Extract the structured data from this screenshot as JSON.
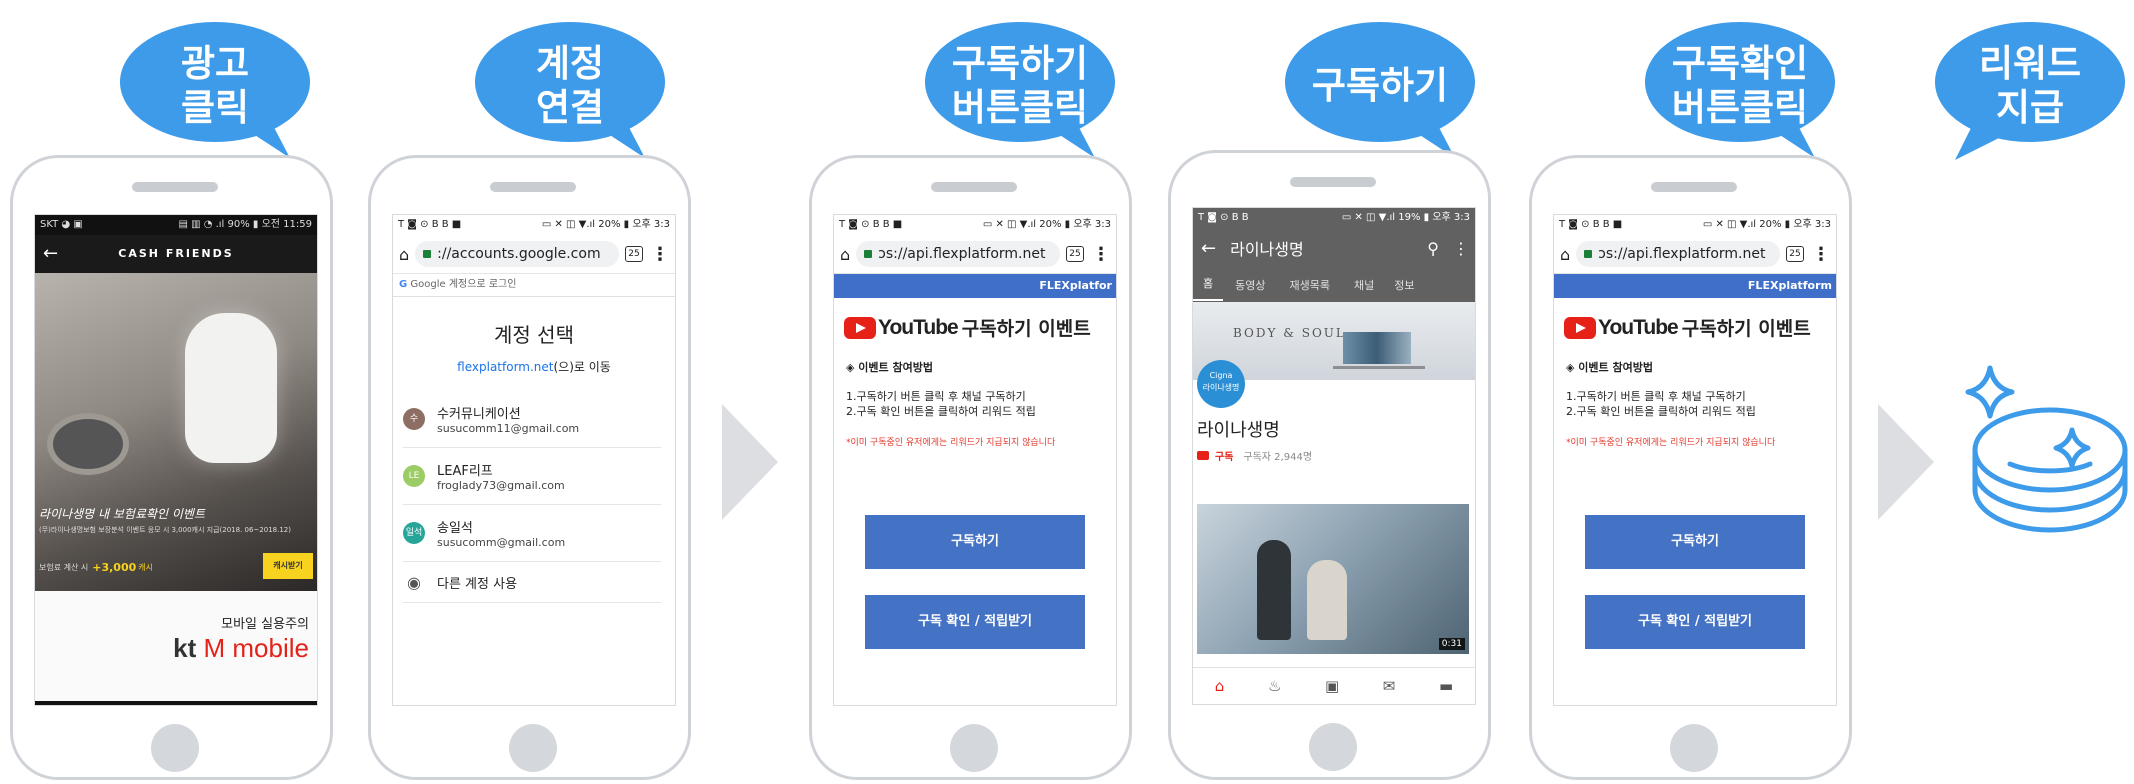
{
  "bubbles": [
    {
      "text": "광고\n클릭"
    },
    {
      "text": "계정\n연결"
    },
    {
      "text": "구독하기\n버튼클릭"
    },
    {
      "text": "구독하기"
    },
    {
      "text": "구독확인\n버튼클릭"
    },
    {
      "text": "리워드\n지급"
    }
  ],
  "colors": {
    "bubble": "#3d9be9",
    "button": "#4472c4",
    "flexbar": "#3f6fc8",
    "youtube_red": "#e62117",
    "warn": "#e23b2e",
    "chevron": "#dcdee2"
  },
  "phone1": {
    "status_left": "SKT ◕ ▣",
    "status_right": "▤ ▥ ◔ .ıl 90% ▮ 오전 11:59",
    "app_title": "CASH FRIENDS",
    "banner_text": "라이나생명 내 보험료확인 이벤트",
    "banner_sub": "(무)라이나생명보험 보장분석 이벤트 응모 시 3,000캐시 지급(2018. 06~2018.12)",
    "reward_label": "보험료 계산 시",
    "reward_value": "+3,000",
    "reward_unit": "캐시",
    "reward_button": "캐시받기",
    "footer_text": "모바일 실용주의",
    "footer_brand_kt": "kt",
    "footer_brand_m": "M mobile"
  },
  "phone2": {
    "status_left": "T ◙ ⊙ B B ■",
    "status_right": "▭ ✕ ◫ ▼.ıl 20% ▮ 오후 3:3",
    "url": "://accounts.google.com",
    "tabs": "25",
    "google_header": "Google 계정으로 로그인",
    "title": "계정 선택",
    "subtitle_link": "flexplatform.net",
    "subtitle_rest": "(으)로 이동",
    "accounts": [
      {
        "initial": "수",
        "name": "수커뮤니케이션",
        "email": "susucomm11@gmail.com",
        "color": "#8d6e63"
      },
      {
        "initial": "LE",
        "name": "LEAF리프",
        "email": "froglady73@gmail.com",
        "color": "#9ccc65"
      },
      {
        "initial": "일석",
        "name": "송일석",
        "email": "susucomm@gmail.com",
        "color": "#26a69a"
      }
    ],
    "other_account": "다른 계정 사용"
  },
  "flexpage": {
    "status_left": "T ◙ ⊙ B B ■",
    "status_right": "▭ ✕ ◫ ▼.ıl 20% ▮ 오후 3:3",
    "url": "ɔs://api.flexplatform.net",
    "tabs": "25",
    "bar_label": "FLEXplatfor",
    "yt_word": "YouTube",
    "event_title": "구독하기 이벤트",
    "section": "◈ 이벤트 참여방법",
    "steps": "1.구독하기 버튼 클릭 후 채널 구독하기\n2.구독 확인 버튼을 클릭하여 리워드 적립",
    "warning": "*이미 구독중인 유저에게는 리워드가 지급되지 않습니다",
    "btn_subscribe": "구독하기",
    "btn_confirm": "구독 확인 / 적립받기"
  },
  "phone5_bar_label": "FLEXplatform",
  "phone4": {
    "status_left": "T ◙ ⊙ B B",
    "status_right": "▭ ✕ ◫ ▼.ıl 19% ▮ 오후 3:3",
    "channel_title": "라이나생명",
    "tabs": [
      "홈",
      "동영상",
      "재생목록",
      "채널",
      "정보"
    ],
    "banner_text": "BODY & SOUL",
    "cigna_badge": "Cigna\n라이나생명",
    "channel_name": "라이나생명",
    "subscribe": "구독",
    "subscribers": "구독자 2,944명",
    "video_time": "0:31"
  }
}
